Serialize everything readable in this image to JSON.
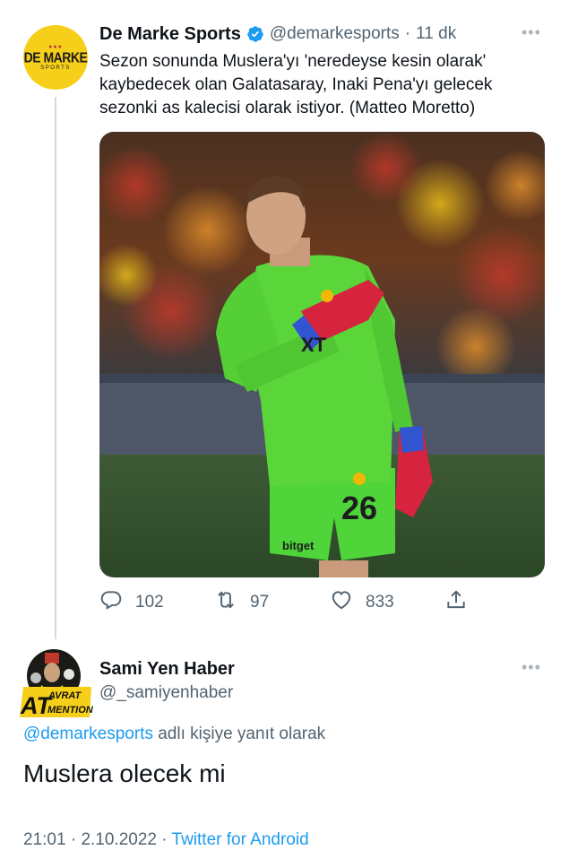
{
  "tweet": {
    "author": {
      "name": "De Marke Sports",
      "handle": "@demarkesports",
      "avatar_text": "DE MARKE",
      "avatar_subtext": "SPORTS",
      "verified": true
    },
    "time_ago": "11 dk",
    "separator": "·",
    "more_icon": "more-horizontal-icon",
    "text": "Sezon sonunda Muslera'yı 'neredeyse kesin olarak' kaybedecek olan Galatasaray, Inaki Pena'yı gelecek sezonki as kalecisi olarak istiyor. (Matteo Moretto)",
    "photo": {
      "description_icon": "goalkeeper-photo",
      "shirt_number": "26",
      "sponsor_text": "bitget"
    },
    "actions": {
      "replies": "102",
      "retweets": "97",
      "likes": "833"
    }
  },
  "reply": {
    "author": {
      "name": "Sami Yen Haber",
      "handle": "@_samiyenhaber",
      "avatar_text_top": "AVRAT",
      "avatar_text_left": "AT",
      "avatar_text_bottom": "MENTION"
    },
    "replying_to": {
      "mention": "@demarkesports",
      "suffix": " adlı kişiye yanıt olarak"
    },
    "text": "Muslera olecek mi",
    "time": "21:01",
    "date": "2.10.2022",
    "source": "Twitter for Android",
    "separator": "·"
  },
  "colors": {
    "accent": "#1d9bf0",
    "secondary_text": "#536471",
    "avatar_yellow": "#f6cf1a",
    "kit_green": "#5ad63a"
  }
}
